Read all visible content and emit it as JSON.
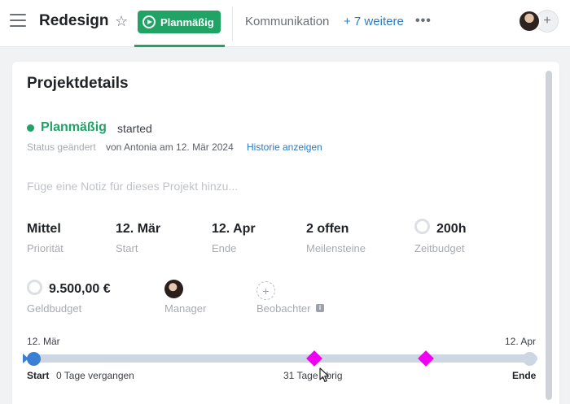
{
  "header": {
    "title": "Redesign",
    "status_label": "Planmäßig",
    "tabs": [
      {
        "label": "Kommunikation"
      },
      {
        "label": "+ 7 weitere"
      }
    ],
    "more_icon": "more-horizontal-icon",
    "add_member_label": "+"
  },
  "details": {
    "title": "Projektdetails",
    "status": {
      "label": "Planmäßig",
      "sub": "started",
      "changed_label": "Status geändert",
      "changed_by": "von Antonia am 12. Mär 2024",
      "history_link": "Historie anzeigen"
    },
    "note_placeholder": "Füge eine Notiz für dieses Projekt hinzu...",
    "fields": [
      {
        "value": "Mittel",
        "label": "Priorität"
      },
      {
        "value": "12. Mär",
        "label": "Start"
      },
      {
        "value": "12. Apr",
        "label": "Ende"
      },
      {
        "value": "2 offen",
        "label": "Meilensteine"
      },
      {
        "value": "200h",
        "label": "Zeitbudget"
      }
    ],
    "money_budget": {
      "value": "9.500,00 €",
      "label": "Geldbudget"
    },
    "manager_label": "Manager",
    "observer_label": "Beobachter",
    "observer_add": "+",
    "info_glyph": "i"
  },
  "timeline": {
    "start_date": "12. Mär",
    "end_date": "12. Apr",
    "start_label": "Start",
    "elapsed": "0 Tage vergangen",
    "remaining": "31 Tage übrig",
    "end_label": "Ende",
    "progress": 0,
    "total_days": 31,
    "milestone_fractions": [
      0.565,
      0.79
    ]
  },
  "colors": {
    "accent_green": "#21a366",
    "link_blue": "#2a7bc0",
    "timeline_blue": "#3a7fd4",
    "milestone_magenta": "#f000f0"
  }
}
